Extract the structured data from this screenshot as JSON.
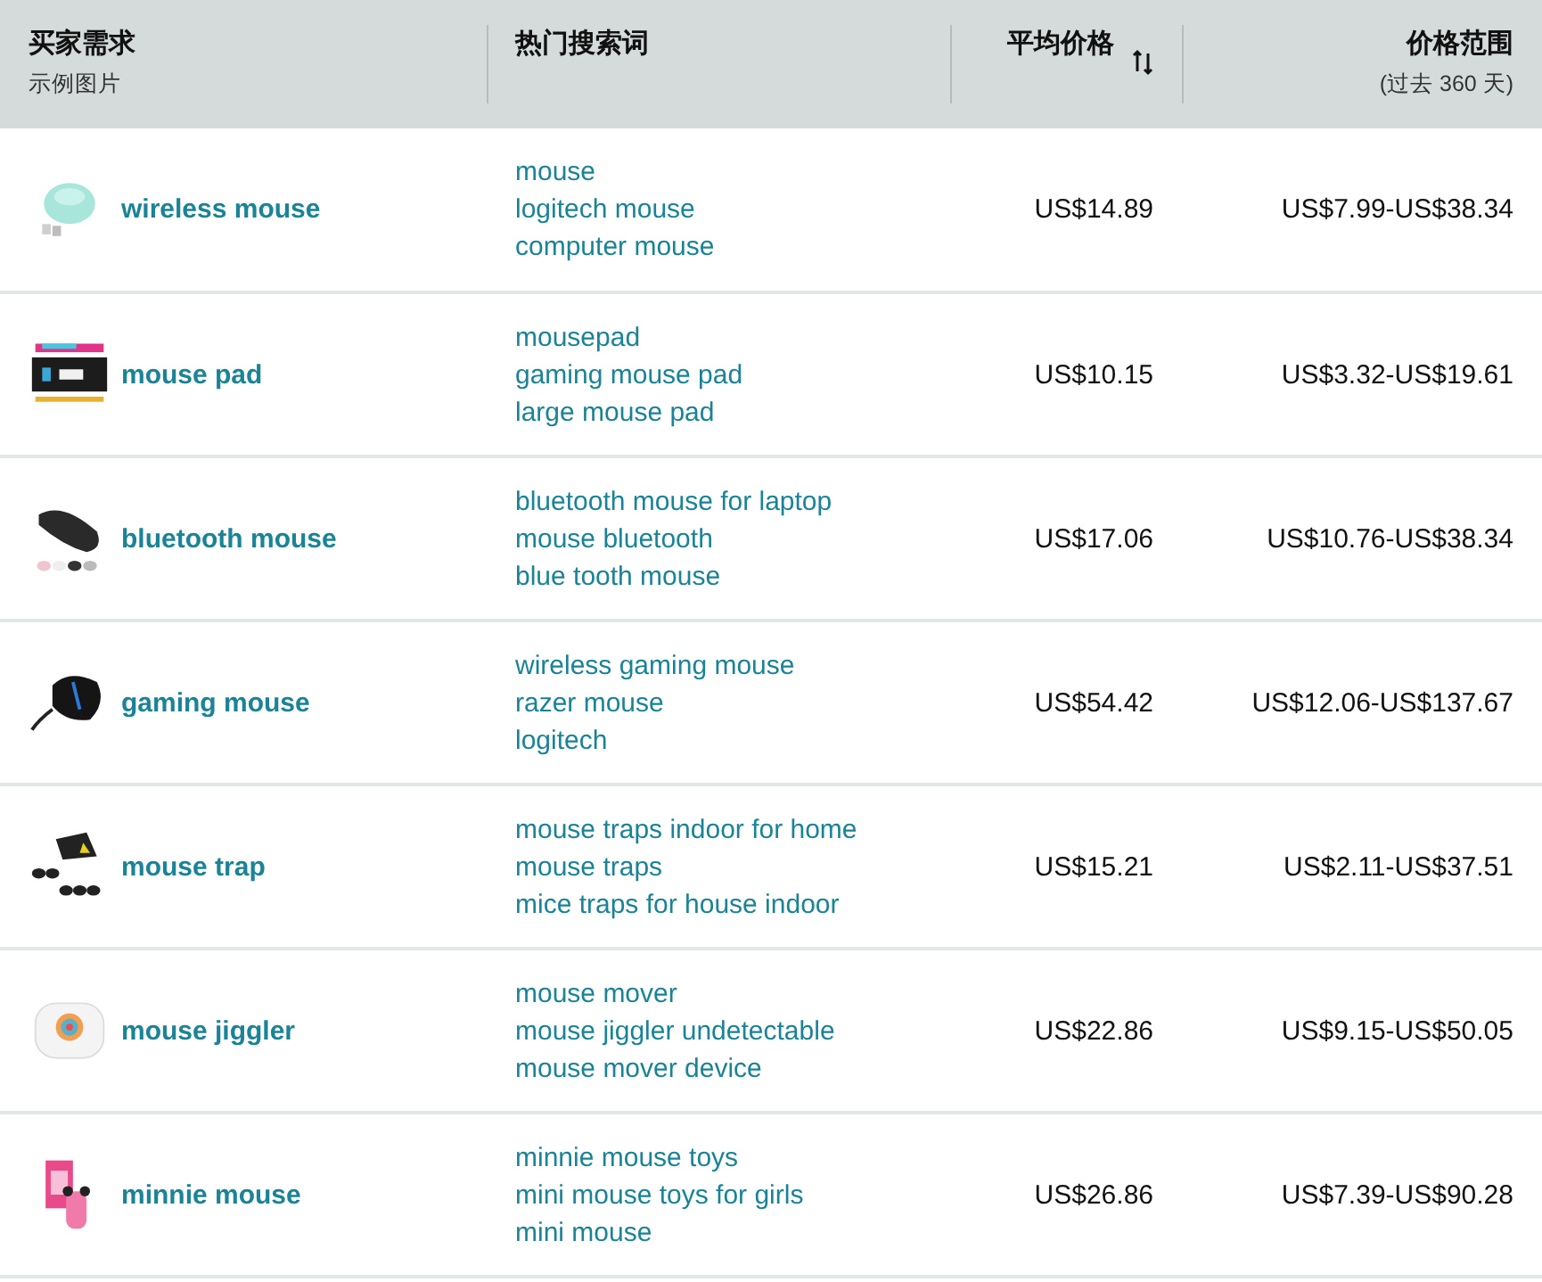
{
  "table": {
    "columns": [
      {
        "title": "买家需求",
        "subtitle": "示例图片"
      },
      {
        "title": "热门搜索词"
      },
      {
        "title": "平均价格",
        "sortable": true
      },
      {
        "title": "价格范围",
        "subtitle": "(过去 360 天)"
      }
    ],
    "rows": [
      {
        "image": {
          "kind": "picture"
        },
        "need": "wireless mouse",
        "terms": [
          "mouse",
          "logitech mouse",
          "computer mouse"
        ],
        "avg_price": "US$14.89",
        "price_range": "US$7.99-US$38.34"
      },
      {
        "image": {
          "kind": "picture"
        },
        "need": "mouse pad",
        "terms": [
          "mousepad",
          "gaming mouse pad",
          "large mouse pad"
        ],
        "avg_price": "US$10.15",
        "price_range": "US$3.32-US$19.61"
      },
      {
        "image": {
          "kind": "picture"
        },
        "need": "bluetooth mouse",
        "terms": [
          "bluetooth mouse for laptop",
          "mouse bluetooth",
          "blue tooth mouse"
        ],
        "avg_price": "US$17.06",
        "price_range": "US$10.76-US$38.34"
      },
      {
        "image": {
          "kind": "picture"
        },
        "need": "gaming mouse",
        "terms": [
          "wireless gaming mouse",
          "razer mouse",
          "logitech"
        ],
        "avg_price": "US$54.42",
        "price_range": "US$12.06-US$137.67"
      },
      {
        "image": {
          "kind": "picture"
        },
        "need": "mouse trap",
        "terms": [
          "mouse traps indoor for home",
          "mouse traps",
          "mice traps for house indoor"
        ],
        "avg_price": "US$15.21",
        "price_range": "US$2.11-US$37.51"
      },
      {
        "image": {
          "kind": "picture"
        },
        "need": "mouse jiggler",
        "terms": [
          "mouse mover",
          "mouse jiggler undetectable",
          "mouse mover device"
        ],
        "avg_price": "US$22.86",
        "price_range": "US$9.15-US$50.05"
      },
      {
        "image": {
          "kind": "picture"
        },
        "need": "minnie mouse",
        "terms": [
          "minnie mouse toys",
          "mini mouse toys for girls",
          "mini mouse"
        ],
        "avg_price": "US$26.86",
        "price_range": "US$7.39-US$90.28"
      }
    ]
  }
}
